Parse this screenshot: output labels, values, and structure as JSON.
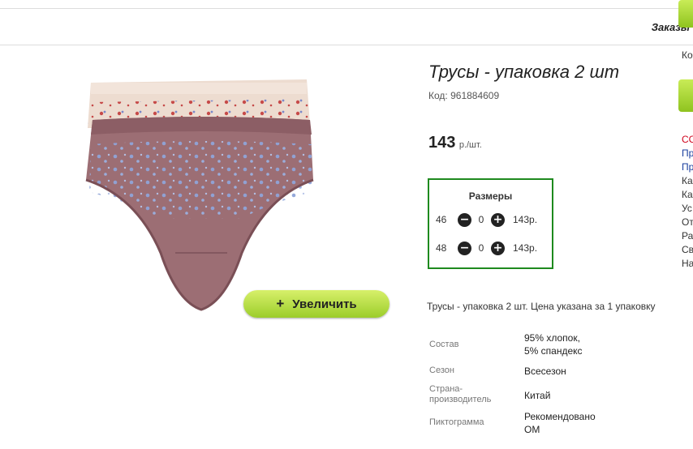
{
  "header": {
    "orders_link": "Заказы"
  },
  "side_panel": {
    "top_text": "Ко",
    "items": [
      {
        "text": "СС",
        "color": "red"
      },
      {
        "text": "Пр",
        "color": "blue"
      },
      {
        "text": "Пр",
        "color": "blue"
      },
      {
        "text": "Ка",
        "color": "dark"
      },
      {
        "text": "Ка",
        "color": "dark"
      },
      {
        "text": "Ус",
        "color": "dark"
      },
      {
        "text": "От",
        "color": "dark"
      },
      {
        "text": "Ра",
        "color": "dark"
      },
      {
        "text": "Св",
        "color": "dark"
      },
      {
        "text": "На",
        "color": "dark"
      }
    ]
  },
  "product": {
    "title": "Трусы - упаковка 2 шт",
    "code_label": "Код:",
    "code_value": "961884609",
    "price": "143",
    "price_unit": "р./шт.",
    "zoom_button_label": "Увеличить",
    "zoom_button_icon": "+",
    "description": "Трусы - упаковка 2 шт. Цена указана за 1 упаковку"
  },
  "sizes": {
    "title": "Размеры",
    "rows": [
      {
        "size": "46",
        "qty": "0",
        "price": "143р."
      },
      {
        "size": "48",
        "qty": "0",
        "price": "143р."
      }
    ],
    "minus_icon": "−",
    "plus_icon": "+"
  },
  "properties": [
    {
      "label": "Состав",
      "value": "95% хлопок,\n5% спандекс"
    },
    {
      "label": "Сезон",
      "value": "Всесезон"
    },
    {
      "label": "Страна-\nпроизводитель",
      "value": "Китай"
    },
    {
      "label": "Пиктограмма",
      "value": "Рекомендовано\nОМ"
    }
  ],
  "colors": {
    "accent_green": "#8fc31f",
    "sizes_border": "#1e8a1e"
  }
}
